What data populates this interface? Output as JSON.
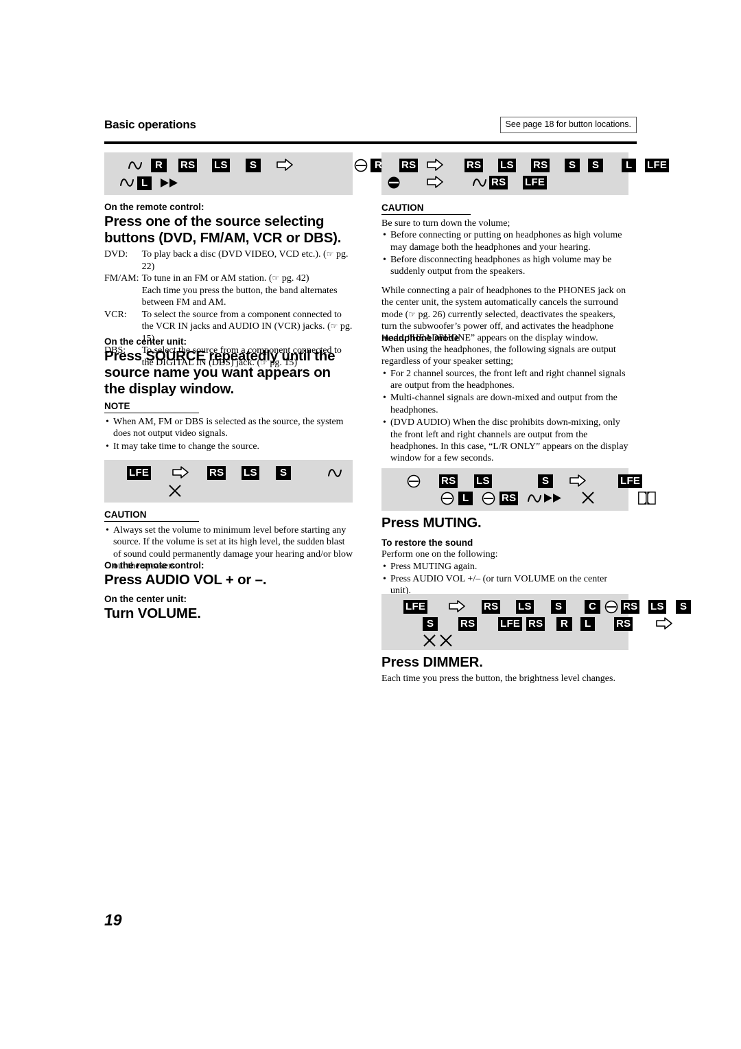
{
  "header": {
    "title": "Basic operations",
    "note": "See page 18 for button locations."
  },
  "page_number": "19",
  "left_column": {
    "section_source": {
      "lead_remote": "On the remote control:",
      "step_remote": "Press one of the source selecting buttons (DVD, FM/AM, VCR or DBS).",
      "definitions": [
        {
          "key": "DVD:",
          "text": "To play back a disc (DVD VIDEO, VCD etc.). (",
          "page_ref": "pg. 22",
          "tail": ")"
        },
        {
          "key": "FM/AM:",
          "text": "To tune in an FM or AM station. (",
          "page_ref": "pg. 42",
          "tail": ")"
        },
        {
          "key": "",
          "text": "Each time you press the button, the band alternates between FM and AM.",
          "page_ref": "",
          "tail": ""
        },
        {
          "key": "VCR:",
          "text": "To select the source from a component connected to the VCR IN jacks and AUDIO IN (VCR) jacks. (",
          "page_ref": "pg. 15",
          "tail": ")"
        },
        {
          "key": "DBS:",
          "text": "To select the source from a component connected to the DIGITAL IN (DBS) jack. (",
          "page_ref": "pg. 15",
          "tail": ")"
        }
      ],
      "lead_center": "On the center unit:",
      "step_center": "Press SOURCE repeatedly until the source name you want appears on the display window.",
      "note_heading": "NOTE",
      "note_bullets": [
        "When AM, FM or DBS is selected as the source, the system does not output video signals.",
        "It may take time to change the source."
      ]
    },
    "section_volume": {
      "caution_heading": "CAUTION",
      "caution_bullets": [
        "Always set the volume to minimum level before starting any source. If the volume is set at its high level, the sudden blast of sound could permanently damage your hearing and/or blow out the speakers."
      ],
      "lead_remote": "On the remote control:",
      "step_remote": "Press AUDIO VOL + or –.",
      "lead_center": "On the center unit:",
      "step_center": "Turn VOLUME."
    }
  },
  "right_column": {
    "section_headphones": {
      "caution_heading": "CAUTION",
      "caution_intro": "Be sure to turn down the volume;",
      "caution_bullets": [
        "Before connecting or putting on headphones as high volume may damage both the headphones and your hearing.",
        "Before disconnecting headphones as high volume may be suddenly output from the speakers."
      ],
      "paragraph_a": "While connecting a pair of headphones to the PHONES jack on the center unit, the system automatically cancels the surround mode (",
      "paragraph_a_ref": "pg. 26",
      "paragraph_b": ") currently selected, deactivates the speakers, turn the subwoofer’s power off, and activates the headphone mode. “HEADPHONE” appears on the display window.",
      "mode_heading": "Headphone mode",
      "mode_intro": "When using the headphones, the following signals are output regardless of your speaker setting;",
      "mode_bullets": [
        "For 2 channel sources, the front left and right channel signals are output from the headphones.",
        "Multi-channel signals are down-mixed and output from the headphones.",
        "(DVD AUDIO) When the disc prohibits down-mixing, only the front left and right channels are output from the headphones. In this case, “L/R ONLY” appears on the display window for a few seconds."
      ]
    },
    "section_muting": {
      "step": "Press MUTING.",
      "subhead": "To restore the sound",
      "intro": "Perform one on the following:",
      "bullets": [
        "Press MUTING again.",
        "Press AUDIO VOL +/– (or turn VOLUME on the center unit)."
      ]
    },
    "section_dimmer": {
      "step": "Press DIMMER.",
      "body": "Each time you press the button, the brightness level changes."
    }
  },
  "banners": [
    {
      "id": "banner-top-left",
      "rows": [
        [
          "wave",
          "R",
          "RS",
          "LS",
          "S",
          "arrow"
        ],
        [
          "wave",
          "L",
          "fastforward"
        ]
      ]
    },
    {
      "id": "banner-top-mid",
      "rows": [
        [
          "circle-minus",
          "R"
        ]
      ]
    },
    {
      "id": "banner-top-right",
      "rows": [
        [
          "RS",
          "arrow",
          "RS",
          "LS",
          "RS",
          "S",
          "S",
          "L",
          "LFE"
        ],
        [
          "circle-minus-filled",
          "arrow",
          "wave",
          "RS",
          "LFE"
        ]
      ]
    },
    {
      "id": "banner-volume",
      "rows": [
        [
          "LFE",
          "arrow",
          "RS",
          "LS",
          "S",
          "wave"
        ],
        [
          "x-cross"
        ]
      ]
    },
    {
      "id": "banner-muting",
      "rows": [
        [
          "circle-minus",
          "RS",
          "LS",
          "S",
          "arrow",
          "LFE"
        ],
        [
          "circle-minus",
          "L",
          "circle-minus",
          "RS",
          "wave",
          "fastforward",
          "x-cross",
          "dolby"
        ]
      ]
    },
    {
      "id": "banner-dimmer",
      "rows": [
        [
          "LFE",
          "arrow",
          "RS",
          "LS",
          "S",
          "C",
          "circle-minus",
          "RS",
          "LS",
          "S"
        ],
        [
          "S",
          "RS",
          "LFE",
          "RS",
          "R",
          "L",
          "RS",
          "arrow"
        ],
        [
          "x-cross",
          "x-cross"
        ]
      ]
    }
  ],
  "colors": {
    "banner_background": "#d9d9d9",
    "glyph_background": "#000000",
    "glyph_foreground": "#ffffff",
    "text": "#000000"
  }
}
